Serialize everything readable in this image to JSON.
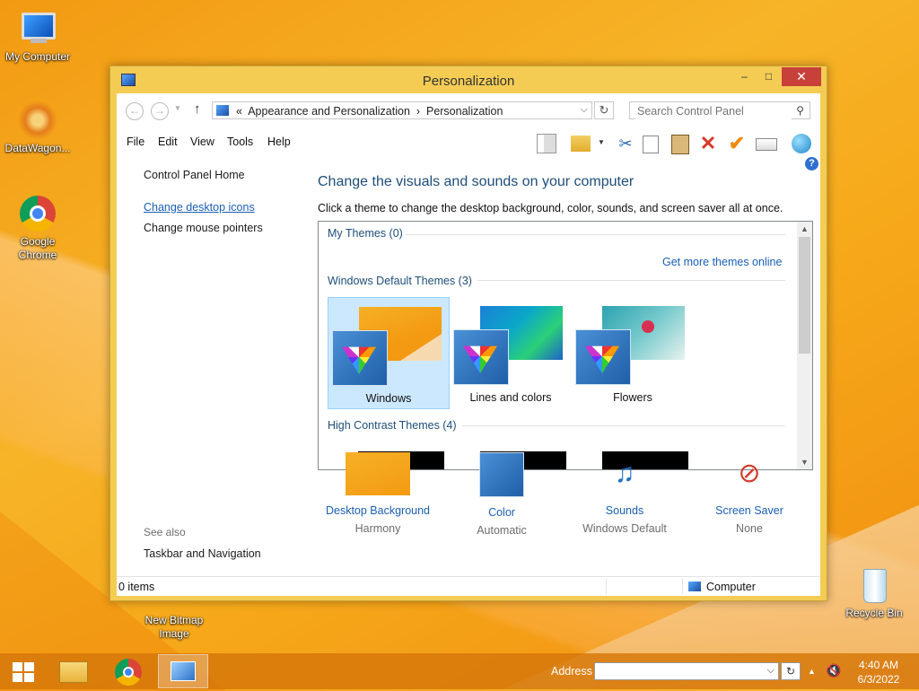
{
  "desktop": {
    "icons": [
      {
        "label": "My Computer"
      },
      {
        "label": "DataWagon..."
      },
      {
        "label": "Google Chrome"
      },
      {
        "label": "New Bitmap Image"
      },
      {
        "label": "Recycle Bin"
      }
    ]
  },
  "window": {
    "title": "Personalization",
    "controls": {
      "minimize": "–",
      "maximize": "□",
      "close": "✕"
    }
  },
  "nav": {
    "back": "←",
    "forward": "→",
    "up": "↑",
    "breadcrumb_prefix": "«",
    "breadcrumb": [
      "Appearance and Personalization",
      "Personalization"
    ],
    "breadcrumb_sep": "›",
    "search_placeholder": "Search Control Panel"
  },
  "menu": [
    "File",
    "Edit",
    "View",
    "Tools",
    "Help"
  ],
  "toolbar_icons": [
    "layout-icon",
    "folder-properties-icon",
    "cut-icon",
    "copy-icon",
    "paste-icon",
    "delete-icon",
    "checkmark-icon",
    "rename-icon",
    "globe-icon"
  ],
  "sidebar": {
    "home": "Control Panel Home",
    "links": [
      "Change desktop icons",
      "Change mouse pointers"
    ],
    "see_also": "See also",
    "see_also_links": [
      "Taskbar and Navigation"
    ]
  },
  "main": {
    "heading": "Change the visuals and sounds on your computer",
    "subtext": "Click a theme to change the desktop background, color, sounds, and screen saver all at once.",
    "my_themes": "My Themes (0)",
    "get_more": "Get more themes online",
    "default_themes": "Windows Default Themes (3)",
    "themes": [
      {
        "name": "Windows",
        "selected": true
      },
      {
        "name": "Lines and colors",
        "selected": false
      },
      {
        "name": "Flowers",
        "selected": false
      }
    ],
    "high_contrast": "High Contrast Themes (4)"
  },
  "bottom": [
    {
      "title": "Desktop Background",
      "subtitle": "Harmony"
    },
    {
      "title": "Color",
      "subtitle": "Automatic"
    },
    {
      "title": "Sounds",
      "subtitle": "Windows Default"
    },
    {
      "title": "Screen Saver",
      "subtitle": "None"
    }
  ],
  "status": {
    "items": "0 items",
    "location": "Computer"
  },
  "taskbar": {
    "address_label": "Address",
    "time": "4:40 AM",
    "date": "6/3/2022"
  },
  "colors": {
    "accent": "#1a5fb4",
    "title_frame": "#f4cc54",
    "close_button": "#c7413a",
    "selection": "#cce8ff"
  }
}
